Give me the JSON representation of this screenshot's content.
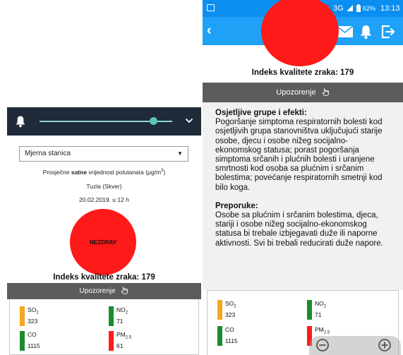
{
  "left_screen": {
    "slider_value": 0.86,
    "station_select": {
      "value": "Mjerna stanica"
    },
    "avg_label": {
      "prefix": "Prosječne ",
      "bold": "satne",
      "suffix": " vrijednost polutanata (μg/m",
      "sup": "3",
      "end": ")"
    },
    "location": "Tuzla (Skver)",
    "datetime": "20.02.2019. u 12 h",
    "aqi_status": "NEZDRAV",
    "aqi_title": "Indeks kvalitete zraka: 179",
    "warning_button": "Upozorenje",
    "pollutants": [
      {
        "name": "SO",
        "sub": "2",
        "value": "323",
        "color": "#f5a623"
      },
      {
        "name": "NO",
        "sub": "2",
        "value": "71",
        "color": "#1a8c2e"
      },
      {
        "name": "CO",
        "sub": "",
        "value": "1115",
        "color": "#1a8c2e"
      },
      {
        "name": "PM",
        "sub": "2.5",
        "value": "61",
        "color": "#ff1a1a"
      }
    ]
  },
  "right_screen": {
    "status_bar": {
      "alarm": "⏰",
      "network": "3G",
      "battery": "62%",
      "time": "13:13",
      "color": "#0a8ff0"
    },
    "app_bar": {
      "back_icon": "‹",
      "color": "#1ea1f7"
    },
    "aqi_title": "Indeks kvalitete zraka: 179",
    "warning_button": "Upozorenje",
    "sensitive_heading": "Osjetljive grupe i efekti:",
    "sensitive_text": "Pogoršanje simptoma respiratornih bolesti kod osjetljivih grupa stanovništva uključujući starije osobe, djecu i osobe nižeg socijalno-ekonomskog statusa; porast pogoršanja simptoma srčanih i plućnih bolesti i uranjene smrtnosti kod osoba sa plućnim i srčanim bolestima; povećanje respiratornih smetnji kod bilo koga.",
    "recommendation_heading": "Preporuke:",
    "recommendation_text": "Osobe sa plućnim i srčanim bolestima, djeca, stariji i osobe nižeg socijalno-ekonomskog statusa bi trebale izbjegavati duže ili naporne aktivnosti. Svi bi trebali reducirati duže napore.",
    "pollutants": [
      {
        "name": "SO",
        "sub": "2",
        "value": "323",
        "color": "#f5a623"
      },
      {
        "name": "NO",
        "sub": "2",
        "value": "71",
        "color": "#1a8c2e"
      },
      {
        "name": "CO",
        "sub": "",
        "value": "1115",
        "color": "#1a8c2e"
      },
      {
        "name": "PM",
        "sub": "2.5",
        "value": "",
        "color": "#ff1a1a"
      }
    ],
    "icons": [
      "mail-icon",
      "bell-icon",
      "logout-icon",
      "zoom-out-icon",
      "zoom-in-icon"
    ]
  },
  "colors": {
    "unhealthy": "#ff1a1a",
    "dark_bar": "#1f2b38",
    "warning_bar": "#5c5c5c",
    "slider": "#5fc4b6"
  }
}
